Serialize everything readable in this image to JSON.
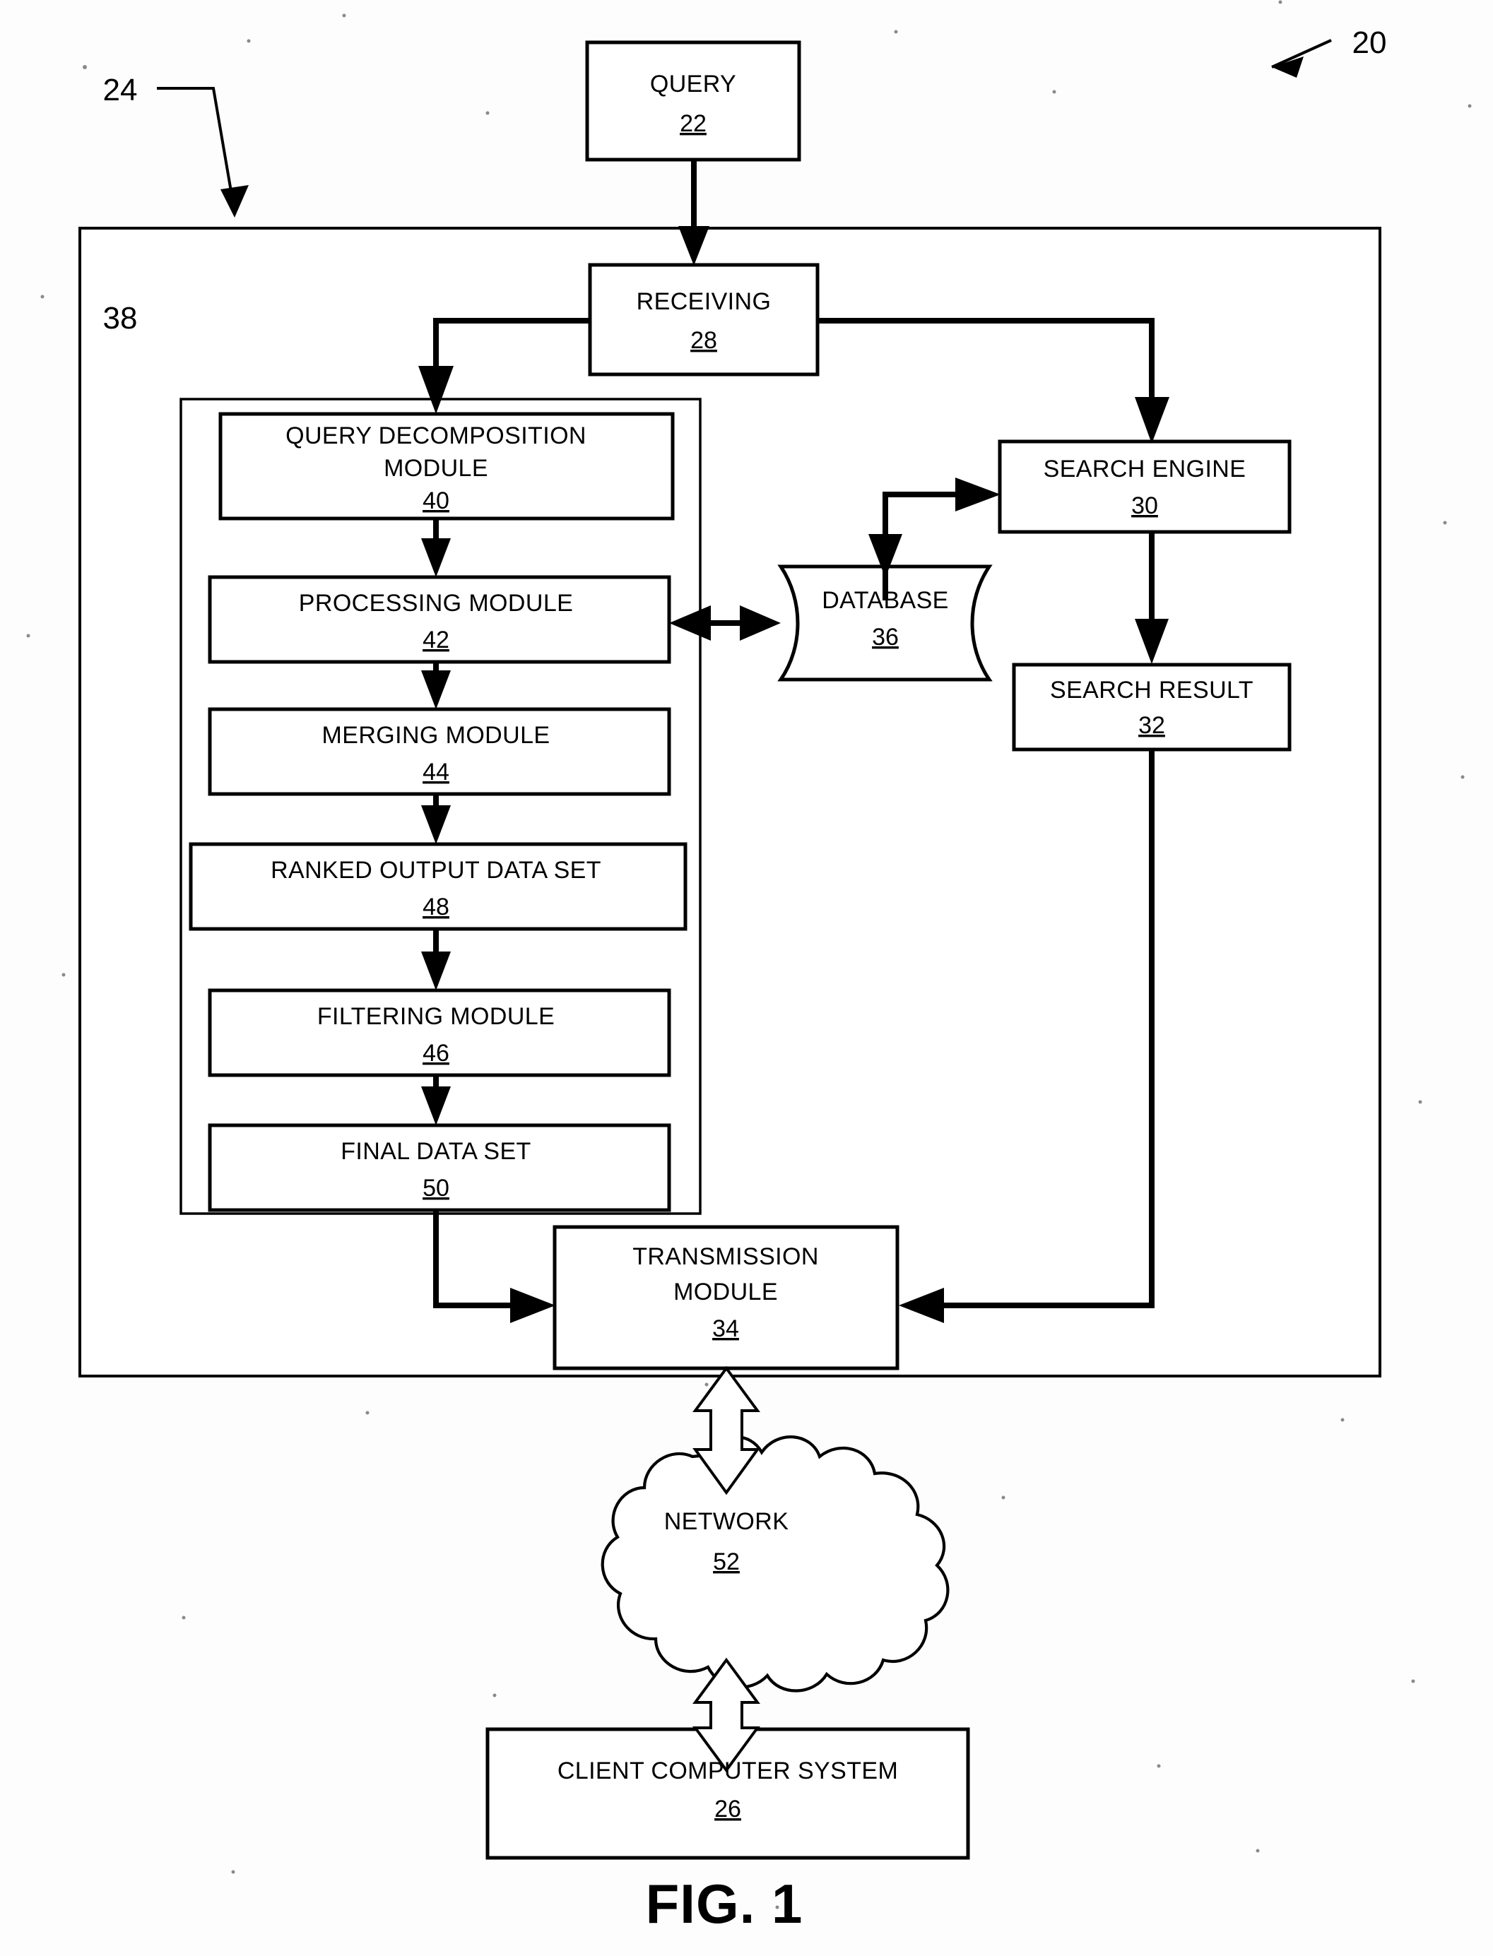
{
  "figure": {
    "caption": "FIG. 1",
    "system_ref": "20",
    "server_ref": "24",
    "engine_group_ref": "38"
  },
  "nodes": {
    "query": {
      "label": "QUERY",
      "ref": "22"
    },
    "receiving": {
      "label": "RECEIVING",
      "ref": "28"
    },
    "search_engine": {
      "label": "SEARCH ENGINE",
      "ref": "30"
    },
    "search_result": {
      "label": "SEARCH RESULT",
      "ref": "32"
    },
    "database": {
      "label": "DATABASE",
      "ref": "36"
    },
    "query_decomp_line1": "QUERY DECOMPOSITION",
    "query_decomp_line2": "MODULE",
    "query_decomp_ref": "40",
    "processing": {
      "label": "PROCESSING MODULE",
      "ref": "42"
    },
    "merging": {
      "label": "MERGING MODULE",
      "ref": "44"
    },
    "ranked_output": {
      "label": "RANKED OUTPUT DATA SET",
      "ref": "48"
    },
    "filtering": {
      "label": "FILTERING MODULE",
      "ref": "46"
    },
    "final_data": {
      "label": "FINAL DATA SET",
      "ref": "50"
    },
    "transmission_line1": "TRANSMISSION",
    "transmission_line2": "MODULE",
    "transmission_ref": "34",
    "network": {
      "label": "NETWORK",
      "ref": "52"
    },
    "client": {
      "label": "CLIENT COMPUTER SYSTEM",
      "ref": "26"
    }
  },
  "colors": {
    "ink": "#000000",
    "paper": "#ffffff"
  }
}
